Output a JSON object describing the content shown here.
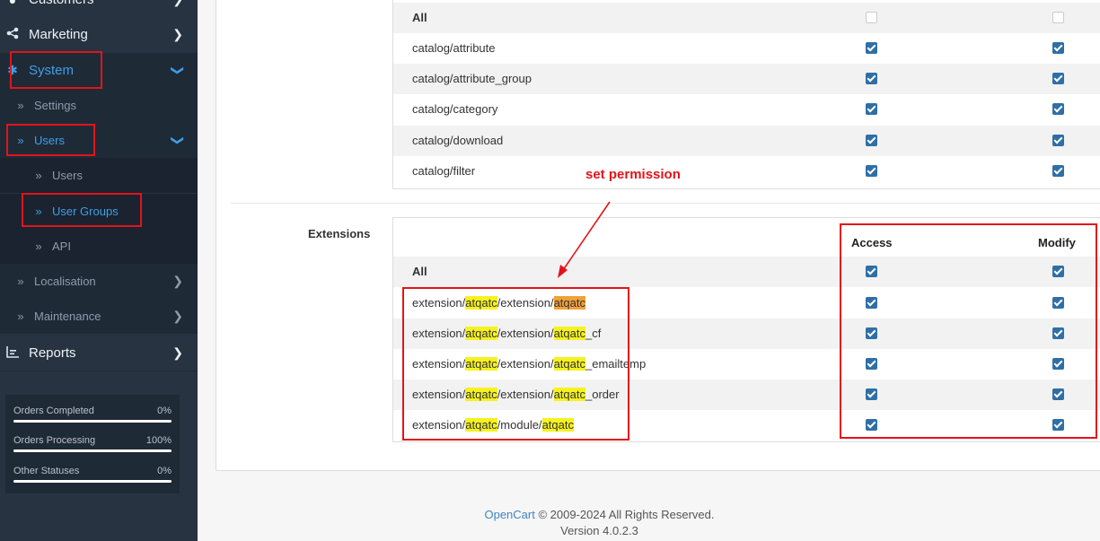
{
  "sidebar": {
    "items": [
      {
        "label": "Customers",
        "icon": "user-icon"
      },
      {
        "label": "Marketing",
        "icon": "share-icon"
      },
      {
        "label": "System",
        "icon": "gear-icon"
      },
      {
        "label": "Settings"
      },
      {
        "label": "Users"
      },
      {
        "label": "Users"
      },
      {
        "label": "User Groups"
      },
      {
        "label": "API"
      },
      {
        "label": "Localisation"
      },
      {
        "label": "Maintenance"
      },
      {
        "label": "Reports",
        "icon": "chart-icon"
      }
    ],
    "stats": [
      {
        "label": "Orders Completed",
        "value": "0%"
      },
      {
        "label": "Orders Processing",
        "value": "100%"
      },
      {
        "label": "Other Statuses",
        "value": "0%"
      }
    ]
  },
  "permissions_top": {
    "all_label": "All",
    "rows": [
      "catalog/attribute",
      "catalog/attribute_group",
      "catalog/category",
      "catalog/download",
      "catalog/filter"
    ]
  },
  "extensions": {
    "section_label": "Extensions",
    "access_header": "Access",
    "modify_header": "Modify",
    "all_label": "All",
    "rows": [
      {
        "p1": "extension/",
        "h1": "atqatc",
        "p2": "/extension/",
        "h2": "atqatc",
        "p3": ""
      },
      {
        "p1": "extension/",
        "h1": "atqatc",
        "p2": "/extension/",
        "h2": "atqatc",
        "p3": "_cf"
      },
      {
        "p1": "extension/",
        "h1": "atqatc",
        "p2": "/extension/",
        "h2": "atqatc",
        "p3": "_emailtemp"
      },
      {
        "p1": "extension/",
        "h1": "atqatc",
        "p2": "/extension/",
        "h2": "atqatc",
        "p3": "_order"
      },
      {
        "p1": "extension/",
        "h1": "atqatc",
        "p2": "/module/",
        "h2": "atqatc",
        "p3": ""
      }
    ]
  },
  "annotation": {
    "text": "set permission"
  },
  "footer": {
    "brand": "OpenCart",
    "copyright": " © 2009-2024 All Rights Reserved.",
    "version": "Version 4.0.2.3"
  },
  "colors": {
    "sidebar_bg": "#283341",
    "active": "#3f9fe8",
    "annotation_red": "#e3131b",
    "highlight": "#f6f21f",
    "checkbox": "#2f6fa6"
  }
}
